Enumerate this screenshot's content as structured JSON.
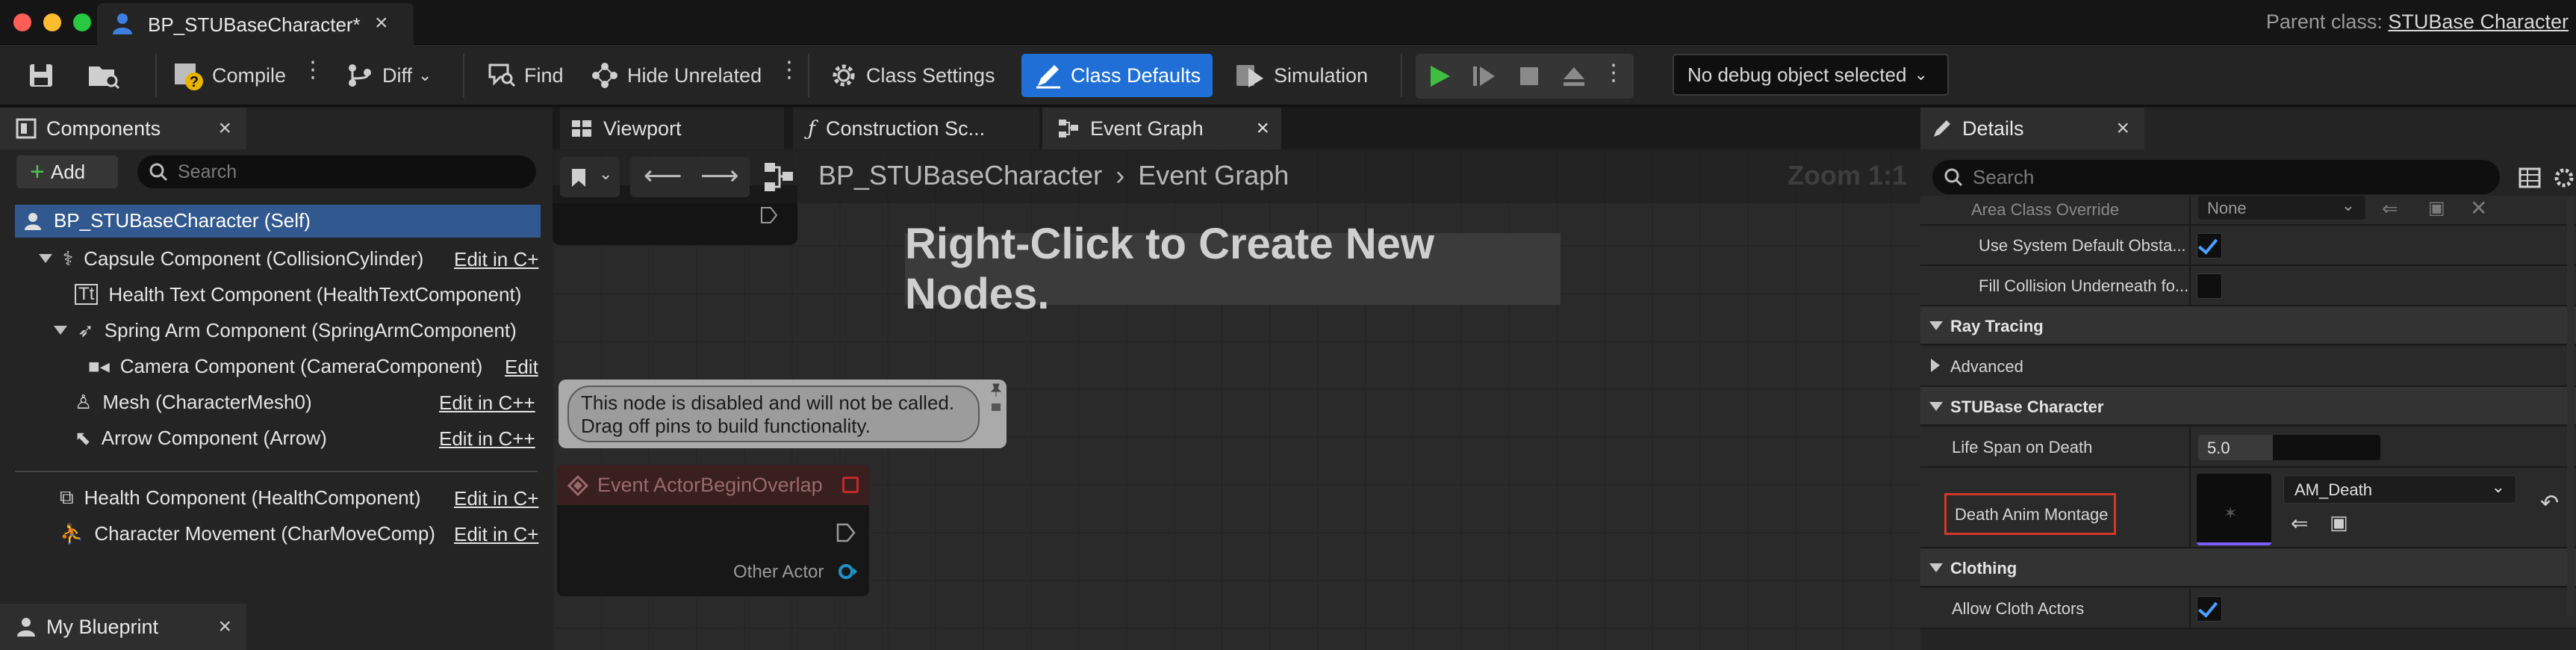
{
  "window": {
    "tab_title": "BP_STUBaseCharacter*",
    "parent_class_label": "Parent class:",
    "parent_class_value": "STUBase Character"
  },
  "toolbar": {
    "compile": "Compile",
    "diff": "Diff",
    "find": "Find",
    "hide_unrelated": "Hide Unrelated",
    "class_settings": "Class Settings",
    "class_defaults": "Class Defaults",
    "simulation": "Simulation",
    "debug_object": "No debug object selected"
  },
  "components": {
    "tab": "Components",
    "add": "Add",
    "search_placeholder": "Search",
    "self": "BP_STUBaseCharacter (Self)",
    "items": [
      {
        "label": "Capsule Component (CollisionCylinder)",
        "edit": "Edit in C+"
      },
      {
        "label": "Health Text Component (HealthTextComponent)",
        "edit": ""
      },
      {
        "label": "Spring Arm Component (SpringArmComponent)",
        "edit": ""
      },
      {
        "label": "Camera Component (CameraComponent)",
        "edit": "Edit"
      },
      {
        "label": "Mesh (CharacterMesh0)",
        "edit": "Edit in C++"
      },
      {
        "label": "Arrow Component (Arrow)",
        "edit": "Edit in C++"
      },
      {
        "label": "Health Component (HealthComponent)",
        "edit": "Edit in C+"
      },
      {
        "label": "Character Movement (CharMoveComp)",
        "edit": "Edit in C+"
      }
    ],
    "my_blueprint_tab": "My Blueprint"
  },
  "graph": {
    "tabs": [
      "Viewport",
      "Construction Sc...",
      "Event Graph"
    ],
    "breadcrumb_root": "BP_STUBaseCharacter",
    "breadcrumb_leaf": "Event Graph",
    "zoom": "Zoom 1:1",
    "hint": "Right-Click to Create New Nodes.",
    "comment_line1": "This node is disabled and will not be called.",
    "comment_line2": "Drag off pins to build functionality.",
    "event_title": "Event ActorBeginOverlap",
    "pin_other_actor": "Other Actor"
  },
  "details": {
    "tab": "Details",
    "search_placeholder": "Search",
    "area_class_override": "Area Class Override",
    "area_class_value": "None",
    "use_system_default": "Use System Default Obsta...",
    "fill_collision": "Fill Collision Underneath fo...",
    "cat_ray_tracing": "Ray Tracing",
    "advanced": "Advanced",
    "cat_stubase": "STUBase Character",
    "life_span_label": "Life Span on Death",
    "life_span_value": "5.0",
    "death_anim_label": "Death Anim Montage",
    "death_anim_value": "AM_Death",
    "cat_clothing": "Clothing",
    "allow_cloth": "Allow Cloth Actors"
  },
  "colors": {
    "accent": "#1f6fd6",
    "selection": "#31598f",
    "highlight_box": "#d0392b",
    "play_green": "#3fbf3f"
  }
}
